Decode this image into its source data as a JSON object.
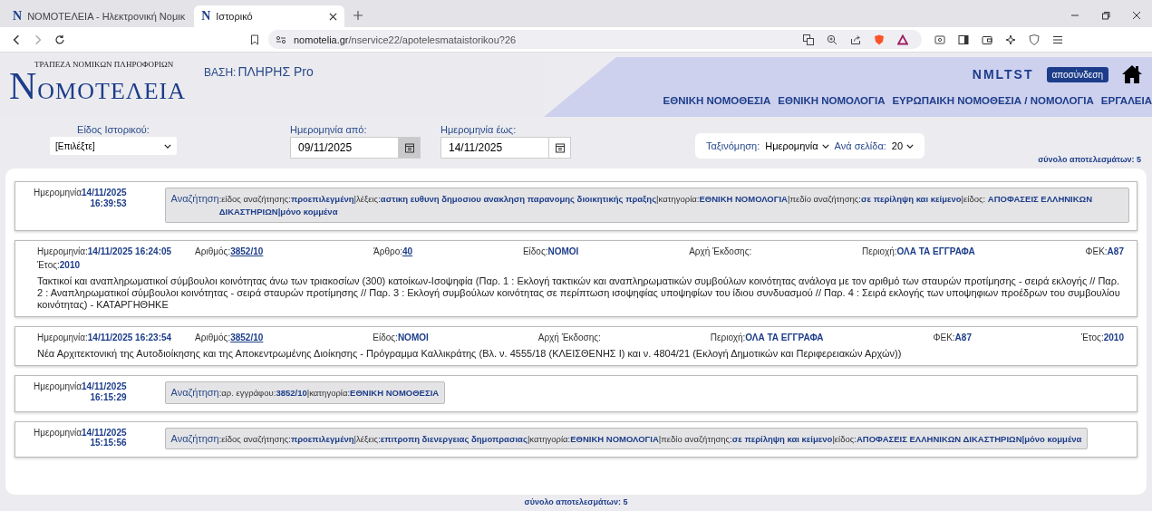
{
  "browser": {
    "tabs": [
      {
        "icon": "N",
        "title": "ΝΟΜΟΤΕΛΕΙΑ - Ηλεκτρονική Νομικ",
        "selected": false
      },
      {
        "icon": "N",
        "title": "Ιστορικό",
        "selected": true
      }
    ],
    "address": {
      "host": "nomotelia.gr",
      "path": "/nservice22/apotelesmataistorikou?26"
    }
  },
  "header": {
    "logo_top": "ΤΡΑΠΕΖΑ ΝΟΜΙΚΩΝ ΠΛΗΡΟΦΟΡΙΩΝ",
    "logo": "ΝΟΜΟΤΕΛΕΙΑ",
    "base_label": "ΒΑΣΗ:",
    "base_value": "ΠΛΗΡΗΣ Pro",
    "user": "NMLTST",
    "logout": "αποσύνδεση",
    "nav": [
      "ΕΘΝΙΚΗ ΝΟΜΟΘΕΣΙΑ",
      "ΕΘΝΙΚΗ ΝΟΜΟΛΟΓΙΑ",
      "ΕΥΡΩΠΑΙΚΗ ΝΟΜΟΘΕΣΙΑ / ΝΟΜΟΛΟΓΙΑ",
      "ΕΡΓΑΛΕΙΑ"
    ]
  },
  "filters": {
    "type": {
      "label": "Είδος Ιστορικού:",
      "value": "[Επιλέξτε]"
    },
    "date_from": {
      "label": "Ημερομηνία από:",
      "value": "09/11/2025"
    },
    "date_to": {
      "label": "Ημερομηνία έως:",
      "value": "14/11/2025"
    },
    "sort": {
      "label": "Ταξινόμηση:",
      "value": "Ημερομηνία"
    },
    "per_page": {
      "label": "Ανά σελίδα:",
      "value": "20"
    }
  },
  "total_top": "σύνολο αποτελεσμάτων: 5",
  "entries": [
    {
      "kind": "search",
      "date_label": "Ημερομηνία",
      "date": "14/11/2025",
      "time": "16:39:53",
      "search_label": "Αναζήτηση",
      "query": ":είδος αναζήτησης:**προεπιλεγμένη**|λέξεις:**αστικη ευθυνη δημοσιου ανακληση παρανομης διοικητικής πραξης**|κατηγορία:**ΕΘΝΙΚΗ ΝΟΜΟΛΟΓΙΑ**|πεδίο αναζήτησης:**σε περίληψη και κείμενο**|είδος: **ΑΠΟΦΑΣΕΙΣ ΕΛΛΗΝΙΚΩΝ ΔΙΚΑΣΤΗΡΙΩΝ|μόνο κομμένα**"
    },
    {
      "kind": "document",
      "rows": [
        [
          {
            "label": "Ημερομηνία:",
            "value": "14/11/2025 16:24:05",
            "link": false
          },
          {
            "label": "Αριθμός:",
            "value": "3852/10",
            "link": true
          },
          {
            "label": "Άρθρο:",
            "value": "40",
            "link": true
          },
          {
            "label": "Είδος:",
            "value": "ΝΟΜΟΙ",
            "link": false
          },
          {
            "label": "Αρχή Έκδοσης:"
          },
          {
            "label": "Περιοχή:",
            "value": "ΟΛΑ ΤΑ ΕΓΓΡΑΦΑ",
            "link": false
          },
          {
            "label": "ΦΕΚ:",
            "value": "A87",
            "link": false
          }
        ],
        [
          {
            "label": "Έτος:",
            "value": "2010",
            "link": false
          }
        ]
      ],
      "text": "Τακτικοί και αναπληρωματικοί σύμβουλοι κοινότητας άνω των τριακοσίων (300) κατοίκων-Ισοψηφία (Παρ. 1 : Εκλογή τακτικών και αναπληρωματικών συμβούλων κοινότητας ανάλογα με τον αριθμό των σταυρών προτίμησης - σειρά εκλογής // Παρ. 2 : Αναπληρωματικοί σύμβουλοι κοινότητας - σειρά σταυρών προτίμησης // Παρ. 3 : Εκλογή συμβούλων κοινότητας σε περίπτωση ισοψηφίας υποψηφίων του ίδιου συνδυασμού // Παρ. 4 : Σειρά εκλογής των υποψηφιων προέδρων του συμβουλίου κοινότητας) - ΚΑΤΑΡΓΗΘΗΚΕ"
    },
    {
      "kind": "document",
      "rows": [
        [
          {
            "label": "Ημερομηνία:",
            "value": "14/11/2025 16:23:54",
            "link": false
          },
          {
            "label": "Αριθμός:",
            "value": "3852/10",
            "link": true
          },
          {
            "label": "Είδος:",
            "value": "ΝΟΜΟΙ",
            "link": false
          },
          {
            "label": "Αρχή Έκδοσης:"
          },
          {
            "label": "Περιοχή:",
            "value": "ΟΛΑ ΤΑ ΕΓΓΡΑΦΑ",
            "link": false
          },
          {
            "label": "ΦΕΚ:",
            "value": "A87",
            "link": false
          },
          {
            "label": "Έτος:",
            "value": "2010",
            "link": false
          }
        ]
      ],
      "text": "Νέα Αρχιτεκτονική της Αυτοδιοίκησης και της Αποκεντρωμένης Διοίκησης - Πρόγραμμα Καλλικράτης (Βλ. ν. 4555/18 (ΚΛΕΙΣΘΕΝΗΣ Ι) και ν. 4804/21 (Εκλογή Δημοτικών και Περιφερειακών Αρχών))"
    },
    {
      "kind": "search",
      "date_label": "Ημερομηνία",
      "date": "14/11/2025",
      "time": "16:15:29",
      "search_label": "Αναζήτηση",
      "query": ":αρ. εγγράφου:**3852/10**|κατηγορία:**ΕΘΝΙΚΗ ΝΟΜΟΘΕΣΙΑ**"
    },
    {
      "kind": "search",
      "date_label": "Ημερομηνία",
      "date": "14/11/2025",
      "time": "15:15:56",
      "search_label": "Αναζήτηση",
      "query": ":είδος αναζήτησης:**προεπιλεγμένη**|λέξεις:**επιτροπη διενεργειας δημοπρασιας**|κατηγορία:**ΕΘΝΙΚΗ ΝΟΜΟΛΟΓΙΑ**|πεδίο αναζήτησης:**σε περίληψη και κείμενο**|είδος:**ΑΠΟΦΑΣΕΙΣ ΕΛΛΗΝΙΚΩΝ ΔΙΚΑΣΤΗΡΙΩΝ|μόνο κομμένα**"
    }
  ],
  "total_bottom": "σύνολο αποτελεσμάτων: 5"
}
